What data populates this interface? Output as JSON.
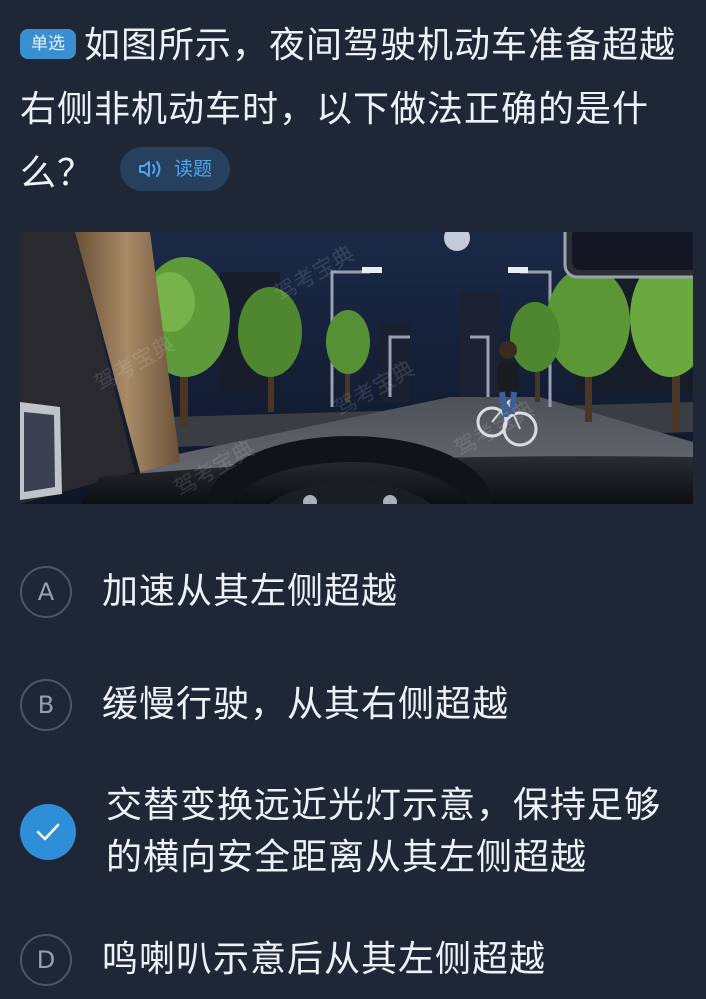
{
  "question": {
    "type_badge": "单选",
    "text": "如图所示，夜间驾驶机动车准备超越右侧非机动车时，以下做法正确的是什么？",
    "read_button_label": "读题",
    "read_button_icon": "speaker-icon"
  },
  "scene": {
    "watermark": "驾考宝典",
    "description_colors": {
      "sky": "#1a2338",
      "road": "#5d5f66",
      "trees": "#5f9a3a",
      "pillar": "#8c6e4e"
    }
  },
  "options": [
    {
      "letter": "A",
      "text": "加速从其左侧超越",
      "selected": false
    },
    {
      "letter": "B",
      "text": "缓慢行驶，从其右侧超越",
      "selected": false
    },
    {
      "letter": "C",
      "text": "交替变换远近光灯示意，保持足够的横向安全距离从其左侧超越",
      "selected": true
    },
    {
      "letter": "D",
      "text": "鸣喇叭示意后从其左侧超越",
      "selected": false
    }
  ],
  "colors": {
    "background": "#1f2736",
    "accent": "#2f8ed8",
    "badge": "#3a8fd1",
    "text": "#eef1f6"
  }
}
